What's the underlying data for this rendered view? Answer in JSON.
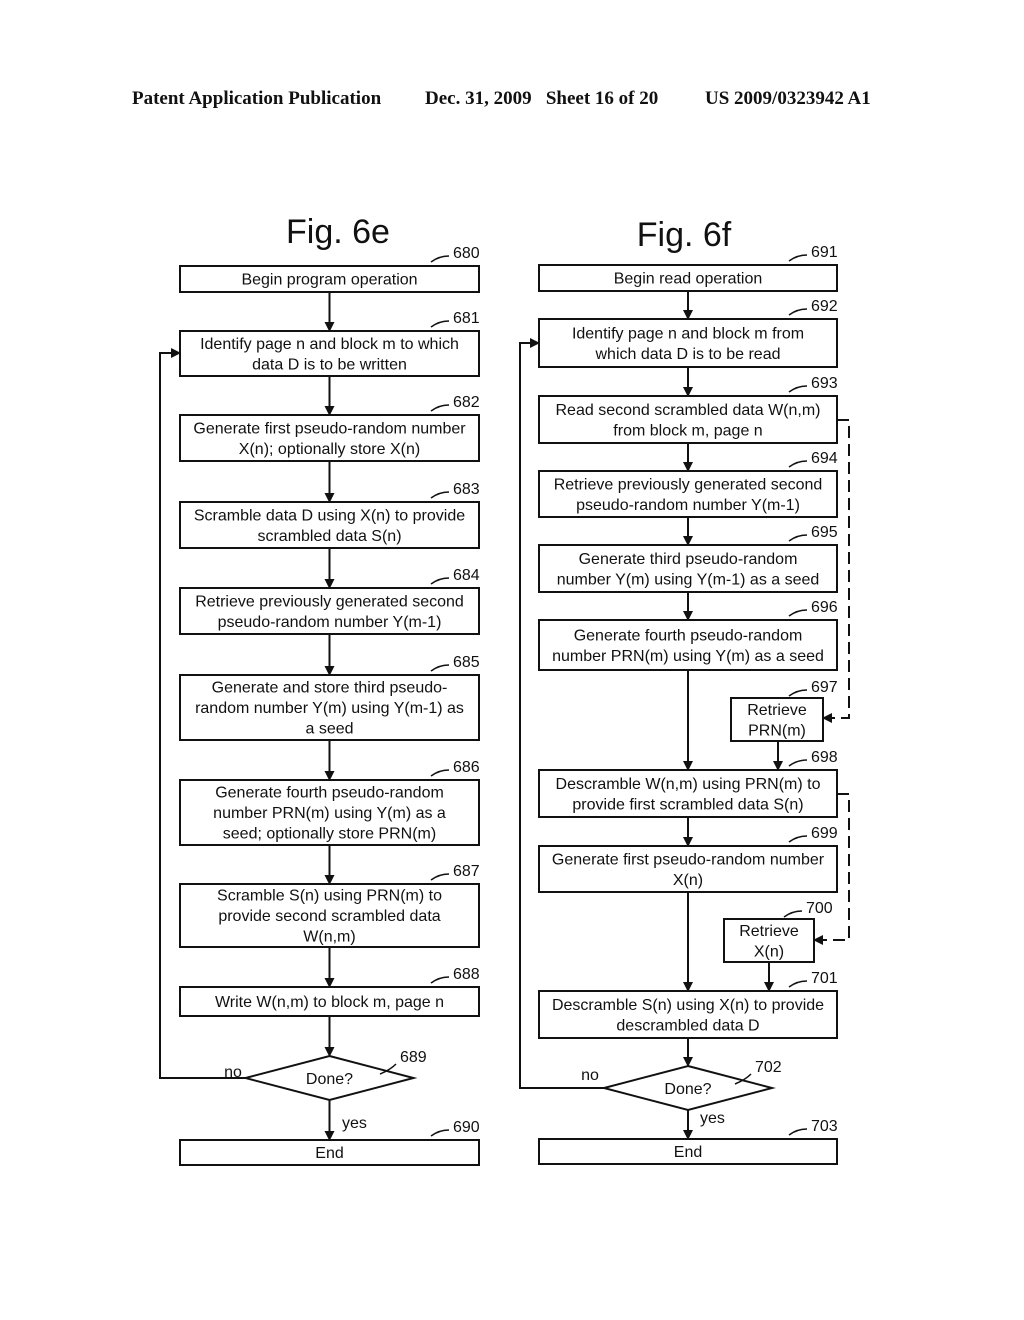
{
  "header": {
    "publication": "Patent Application Publication",
    "date_sheet": "Dec. 31, 2009   Sheet 16 of 20",
    "patent_number": "US 2009/0323942 A1"
  },
  "fig_6e": {
    "title": "Fig. 6e",
    "steps": [
      {
        "ref": "680",
        "lines": [
          "Begin program operation"
        ]
      },
      {
        "ref": "681",
        "lines": [
          "Identify page n and block m to which",
          "data D is to be written"
        ]
      },
      {
        "ref": "682",
        "lines": [
          "Generate first pseudo-random number",
          "X(n); optionally store X(n)"
        ]
      },
      {
        "ref": "683",
        "lines": [
          "Scramble data D using X(n) to provide",
          "scrambled data S(n)"
        ]
      },
      {
        "ref": "684",
        "lines": [
          "Retrieve previously generated second",
          "pseudo-random number Y(m-1)"
        ]
      },
      {
        "ref": "685",
        "lines": [
          "Generate and store third pseudo-",
          "random number Y(m) using Y(m-1) as",
          "a seed"
        ]
      },
      {
        "ref": "686",
        "lines": [
          "Generate fourth pseudo-random",
          "number PRN(m) using Y(m) as a",
          "seed; optionally store PRN(m)"
        ]
      },
      {
        "ref": "687",
        "lines": [
          "Scramble S(n) using PRN(m) to",
          "provide second scrambled data",
          "W(n,m)"
        ]
      },
      {
        "ref": "688",
        "lines": [
          "Write W(n,m) to block m, page n"
        ]
      }
    ],
    "decision": {
      "ref": "689",
      "label": "Done?",
      "no": "no",
      "yes": "yes"
    },
    "end": {
      "ref": "690",
      "label": "End"
    }
  },
  "fig_6f": {
    "title": "Fig. 6f",
    "steps": [
      {
        "ref": "691",
        "lines": [
          "Begin read operation"
        ]
      },
      {
        "ref": "692",
        "lines": [
          "Identify page n and block m from",
          "which data D is to be read"
        ]
      },
      {
        "ref": "693",
        "lines": [
          "Read second scrambled data W(n,m)",
          "from block m, page n"
        ]
      },
      {
        "ref": "694",
        "lines": [
          "Retrieve previously generated second",
          "pseudo-random number Y(m-1)"
        ]
      },
      {
        "ref": "695",
        "lines": [
          "Generate third pseudo-random",
          "number Y(m) using Y(m-1) as a seed"
        ]
      },
      {
        "ref": "696",
        "lines": [
          "Generate fourth pseudo-random",
          "number PRN(m) using Y(m) as a seed"
        ]
      },
      {
        "ref": "697",
        "lines": [
          "Retrieve",
          "PRN(m)"
        ]
      },
      {
        "ref": "698",
        "lines": [
          "Descramble W(n,m) using PRN(m) to",
          "provide first scrambled data S(n)"
        ]
      },
      {
        "ref": "699",
        "lines": [
          "Generate first pseudo-random number",
          "X(n)"
        ]
      },
      {
        "ref": "700",
        "lines": [
          "Retrieve",
          "X(n)"
        ]
      },
      {
        "ref": "701",
        "lines": [
          "Descramble S(n) using X(n) to provide",
          "descrambled data D"
        ]
      }
    ],
    "decision": {
      "ref": "702",
      "label": "Done?",
      "no": "no",
      "yes": "yes"
    },
    "end": {
      "ref": "703",
      "label": "End"
    }
  }
}
